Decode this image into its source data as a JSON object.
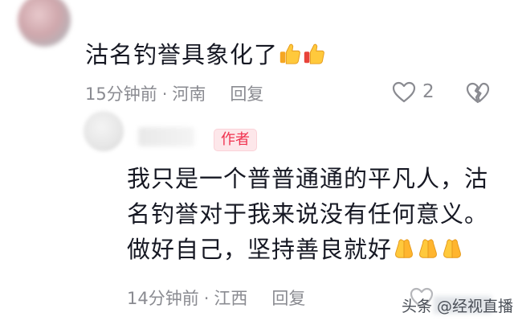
{
  "comment": {
    "text": "沽名钓誉具象化了",
    "emoji": [
      "thumbs-up-emoji",
      "thumbs-up-emoji"
    ],
    "time": "15分钟前",
    "separator": "·",
    "location": "河南",
    "reply_label": "回复",
    "like_count": "2"
  },
  "reply": {
    "author_badge": "作者",
    "lines": [
      "我只是一个普普通通的平凡人，沽",
      "名钓誉对于我来说没有任何意义。",
      "做好自己，坚持善良就好"
    ],
    "emoji": [
      "folded-hands-emoji",
      "folded-hands-emoji",
      "folded-hands-emoji"
    ],
    "time": "14分钟前",
    "separator": "·",
    "location": "江西",
    "reply_label": "回复"
  },
  "watermark": {
    "text": "头条 @经视直播"
  },
  "colors": {
    "text": "#161823",
    "meta": "#8a8b91",
    "author_badge_text": "#f0324f",
    "author_badge_bg": "#fde7ea"
  }
}
